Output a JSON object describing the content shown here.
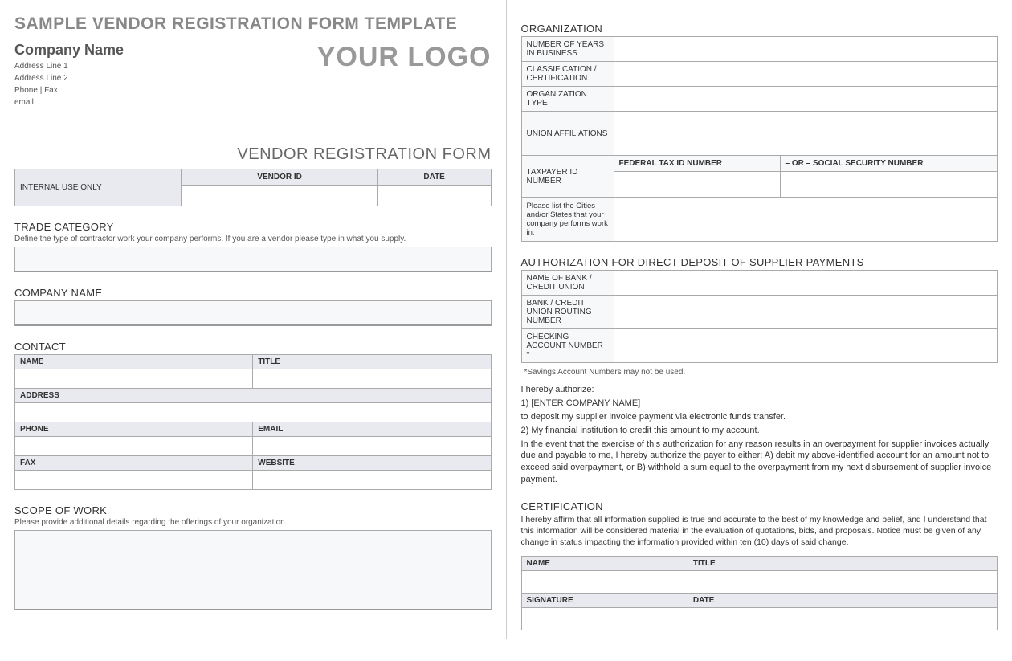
{
  "left": {
    "title": "SAMPLE VENDOR REGISTRATION FORM TEMPLATE",
    "company_name": "Company Name",
    "address_line_1": "Address Line 1",
    "address_line_2": "Address Line 2",
    "phone_fax": "Phone | Fax",
    "email": "email",
    "logo_text": "YOUR LOGO",
    "subheading": "VENDOR REGISTRATION FORM",
    "internal_use": {
      "label": "INTERNAL USE ONLY",
      "vendor_id_head": "VENDOR ID",
      "date_head": "DATE"
    },
    "trade": {
      "heading": "TRADE CATEGORY",
      "desc": "Define the type of contractor work your company performs. If you are a vendor please type in what you supply."
    },
    "company": {
      "heading": "COMPANY NAME"
    },
    "contact": {
      "heading": "CONTACT",
      "name": "NAME",
      "title": "TITLE",
      "address": "ADDRESS",
      "phone": "PHONE",
      "email": "EMAIL",
      "fax": "FAX",
      "website": "WEBSITE"
    },
    "scope": {
      "heading": "SCOPE OF WORK",
      "desc": "Please provide additional details regarding the offerings of your organization."
    }
  },
  "right": {
    "org": {
      "heading": "ORGANIZATION",
      "years": "NUMBER OF YEARS IN BUSINESS",
      "classification": "CLASSIFICATION / CERTIFICATION",
      "type": "ORGANIZATION TYPE",
      "union": "UNION AFFILIATIONS",
      "taxpayer": "TAXPAYER ID NUMBER",
      "fed_tax": "FEDERAL TAX ID NUMBER",
      "or_ssn": "– OR –   SOCIAL SECURITY NUMBER",
      "cities": "Please list the Cities and/or States that your company performs work in."
    },
    "deposit": {
      "heading": "AUTHORIZATION FOR DIRECT DEPOSIT OF SUPPLIER PAYMENTS",
      "bank": "NAME OF BANK / CREDIT UNION",
      "routing": "BANK / CREDIT UNION ROUTING NUMBER",
      "checking": "CHECKING ACCOUNT NUMBER *",
      "footnote": "*Savings Account Numbers may not be used."
    },
    "auth": {
      "line1": "I hereby authorize:",
      "line2": "1) [ENTER COMPANY NAME]",
      "line3": "to deposit my supplier invoice payment via electronic funds transfer.",
      "line4": "2) My financial institution to credit this amount to my account.",
      "line5": "In the event that the exercise of this authorization for any reason results in an overpayment for supplier invoices actually due and payable to me, I hereby authorize the payer to either: A) debit my above-identified account for an amount not to exceed said overpayment, or B) withhold a sum equal to the overpayment from my next disbursement of supplier invoice payment."
    },
    "cert": {
      "heading": "CERTIFICATION",
      "text": "I hereby affirm that all information supplied is true and accurate to the best of my knowledge and belief, and I understand that this information will be considered material in the evaluation of quotations, bids, and proposals. Notice must be given of any change in status impacting the information provided within ten (10) days of said change."
    },
    "sig": {
      "name": "NAME",
      "title": "TITLE",
      "signature": "SIGNATURE",
      "date": "DATE"
    }
  }
}
